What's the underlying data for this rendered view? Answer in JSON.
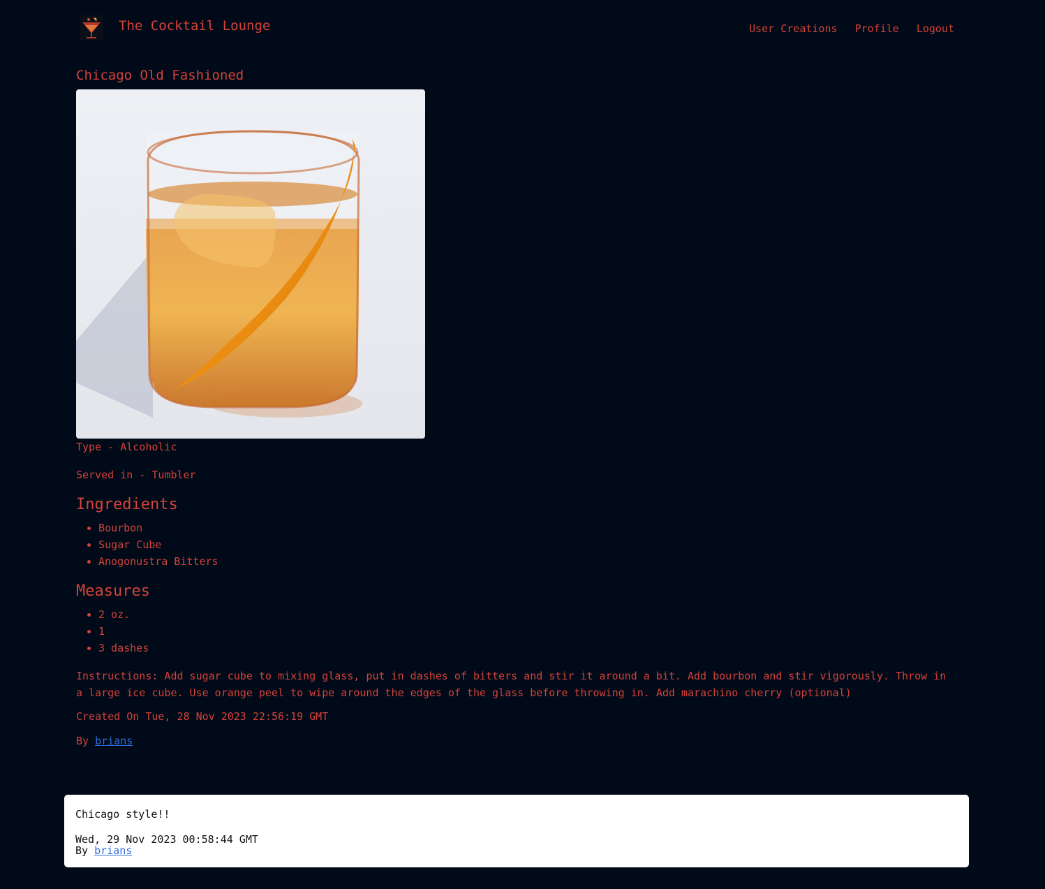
{
  "header": {
    "site_title": "The Cocktail Lounge",
    "nav": [
      {
        "label": "User Creations"
      },
      {
        "label": "Profile"
      },
      {
        "label": "Logout"
      }
    ]
  },
  "drink": {
    "title": "Chicago Old Fashioned",
    "type_line": "Type - Alcoholic",
    "served_line": "Served in - Tumbler",
    "ingredients_heading": "Ingredients",
    "ingredients": [
      "Bourbon",
      "Sugar Cube",
      "Anogonustra Bitters"
    ],
    "measures_heading": "Measures",
    "measures": [
      "2 oz.",
      "1",
      "3 dashes"
    ],
    "instructions": "Instructions: Add sugar cube to mixing glass, put in dashes of bitters and stir it around a bit. Add bourbon and stir vigorously. Throw in a large ice cube. Use orange peel to wipe around the edges of the glass before throwing in. Add marachino cherry (optional)",
    "created": "Created On Tue, 28 Nov 2023 22:56:19 GMT",
    "by_prefix": "By",
    "author": "brians"
  },
  "comment": {
    "text": "Chicago style!!",
    "date": "Wed, 29 Nov 2023 00:58:44 GMT",
    "by_prefix": "By",
    "author": "brians"
  },
  "colors": {
    "background": "#010a18",
    "accent": "#d4423a",
    "link": "#2f6fdb"
  }
}
